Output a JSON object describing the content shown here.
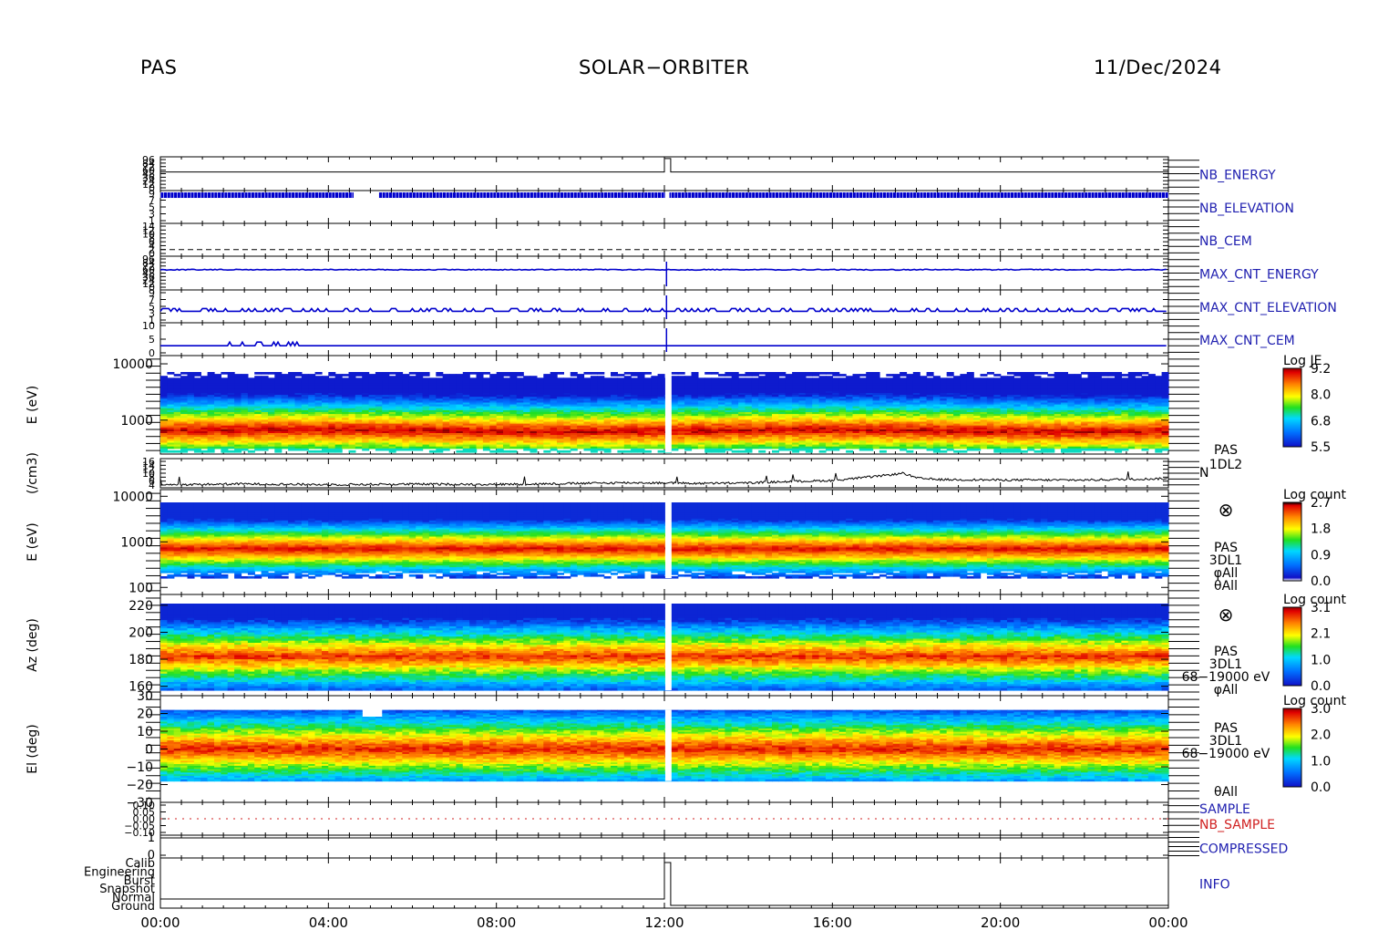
{
  "header": {
    "instrument": "PAS",
    "mission": "SOLAR−ORBITER",
    "date": "11/Dec/2024"
  },
  "colors": {
    "axis": "#000000",
    "label_blue": "#2020b0",
    "label_red": "#d02020",
    "trace_blue": "#0000cc",
    "trace_black": "#000000"
  },
  "chart_data": [
    {
      "type": "line",
      "name": "NB_ENERGY",
      "tick_labels": [
        "96",
        "84",
        "72",
        "60",
        "48",
        "36",
        "24",
        "12",
        "0"
      ],
      "trace": {
        "x_hours": [
          0,
          12.0,
          12.0,
          12.15,
          12.15,
          24
        ],
        "level": [
          0.55,
          0.55,
          0.95,
          0.95,
          0.55,
          0.55
        ]
      }
    },
    {
      "type": "line",
      "name": "NB_ELEVATION",
      "tick_labels": [
        "9",
        "7",
        "5",
        "3",
        "1"
      ],
      "trace": {
        "level": 0.86,
        "gap_hours": [
          4.6,
          5.2
        ]
      }
    },
    {
      "type": "line",
      "name": "NB_CEM",
      "tick_labels": [
        "14",
        "12",
        "10",
        "8",
        "6",
        "4",
        "2",
        "0"
      ],
      "trace": {
        "level": 0.2,
        "style": "dashed"
      }
    },
    {
      "type": "line",
      "name": "MAX_CNT_ENERGY",
      "tick_labels": [
        "96",
        "84",
        "72",
        "60",
        "48",
        "36",
        "24",
        "12",
        "0"
      ],
      "trace": {
        "level": 0.6,
        "spike_hours": 12.05
      }
    },
    {
      "type": "line",
      "name": "MAX_CNT_ELEVATION",
      "tick_labels": [
        "9",
        "7",
        "5",
        "3",
        "1"
      ],
      "trace": {
        "level": 0.35,
        "spike_hours": 12.05
      }
    },
    {
      "type": "line",
      "name": "MAX_CNT_CEM",
      "tick_labels": [
        "10",
        "5",
        "0"
      ],
      "trace": {
        "level": 0.3,
        "spike_hours": 12.05
      }
    },
    {
      "type": "heatmap",
      "name": "PAS 1DL2 energy spectrogram",
      "ylabel": "E (eV)",
      "yscale": "log",
      "ylim": [
        250,
        14000
      ],
      "ytick_labels": [
        "10000",
        "1000"
      ],
      "ytick_values": [
        10000,
        1000
      ],
      "colorbar": {
        "title": "Log JE",
        "ticks": [
          "9.2",
          "8.0",
          "6.8",
          "5.5"
        ],
        "range": [
          5.5,
          9.2
        ]
      },
      "peak_energy_ev": 650
    },
    {
      "type": "line",
      "name": "N",
      "ylabel": "(/cm3)",
      "legend": [
        "PAS",
        "1DL2",
        "N"
      ],
      "tick_labels": [
        "16",
        "14",
        "12",
        "10",
        "8",
        "6",
        "4"
      ],
      "ylim": [
        4,
        16
      ],
      "x_hours": [
        0,
        2,
        4,
        6,
        8,
        10,
        11,
        12,
        13,
        14,
        15,
        16,
        17,
        17.7,
        18,
        18.5,
        20,
        22,
        24
      ],
      "values": [
        5.2,
        5.6,
        5.3,
        5.5,
        5.4,
        5.8,
        6.1,
        6.0,
        5.8,
        6.0,
        6.6,
        7.0,
        8.6,
        10.0,
        8.0,
        7.4,
        7.2,
        7.2,
        7.8
      ]
    },
    {
      "type": "heatmap",
      "name": "PAS 3DL1 energy spectrogram",
      "ylabel": "E (eV)",
      "yscale": "log",
      "ylim": [
        70,
        14000
      ],
      "ytick_labels": [
        "10000",
        "1000",
        "100"
      ],
      "ytick_values": [
        10000,
        1000,
        100
      ],
      "legend": [
        "PAS",
        "3DL1",
        "φAll",
        "θAll"
      ],
      "colorbar": {
        "title": "Log count",
        "ticks": [
          "2.7",
          "1.8",
          "0.9",
          "0.0"
        ],
        "range": [
          0.0,
          2.7
        ]
      },
      "peak_energy_ev": 700
    },
    {
      "type": "heatmap",
      "name": "PAS 3DL1 azimuth spectrogram",
      "ylabel": "Az (deg)",
      "ylim": [
        153,
        228
      ],
      "ytick_labels": [
        "220",
        "200",
        "180",
        "160"
      ],
      "ytick_values": [
        220,
        200,
        180,
        160
      ],
      "legend": [
        "PAS",
        "3DL1",
        "68−19000 eV",
        "φAll"
      ],
      "colorbar": {
        "title": "Log count",
        "ticks": [
          "3.1",
          "2.1",
          "1.0",
          "0.0"
        ],
        "range": [
          0.0,
          3.1
        ]
      },
      "peak_deg": 182
    },
    {
      "type": "heatmap",
      "name": "PAS 3DL1 elevation spectrogram",
      "ylabel": "El (deg)",
      "ylim": [
        -30,
        30
      ],
      "ytick_labels": [
        "30",
        "20",
        "10",
        "0",
        "−10",
        "−20",
        "−30"
      ],
      "ytick_values": [
        30,
        20,
        10,
        0,
        -10,
        -20,
        -30
      ],
      "legend": [
        "PAS",
        "3DL1",
        "68−19000 eV",
        "θAll"
      ],
      "colorbar": {
        "title": "Log count",
        "ticks": [
          "3.0",
          "2.0",
          "1.0",
          "0.0"
        ],
        "range": [
          0.0,
          3.0
        ]
      },
      "peak_deg": 0
    },
    {
      "type": "line",
      "name": "SAMPLE",
      "series_labels": [
        "SAMPLE",
        "NB_SAMPLE"
      ],
      "tick_labels": [
        "0.10",
        "0.05",
        "0.00",
        "−0.05",
        "−0.10"
      ],
      "value": 0.0
    },
    {
      "type": "line",
      "name": "COMPRESSED",
      "tick_labels": [
        "1",
        "0"
      ],
      "value": 1
    },
    {
      "type": "line",
      "name": "INFO",
      "tick_labels": [
        "Calib",
        "Engineering",
        "Burst",
        "Snapshot",
        "Normal",
        "Ground"
      ],
      "trace": {
        "x_hours": [
          0,
          12.0,
          12.0,
          12.15,
          12.15,
          24
        ],
        "level_index": [
          -1,
          -1,
          0,
          0,
          5,
          5
        ]
      }
    }
  ],
  "x_axis": {
    "tick_labels": [
      "00:00",
      "04:00",
      "08:00",
      "12:00",
      "16:00",
      "20:00",
      "00:00"
    ],
    "range_hours": [
      0,
      24
    ]
  },
  "crossed_circle_symbol": "⊗"
}
